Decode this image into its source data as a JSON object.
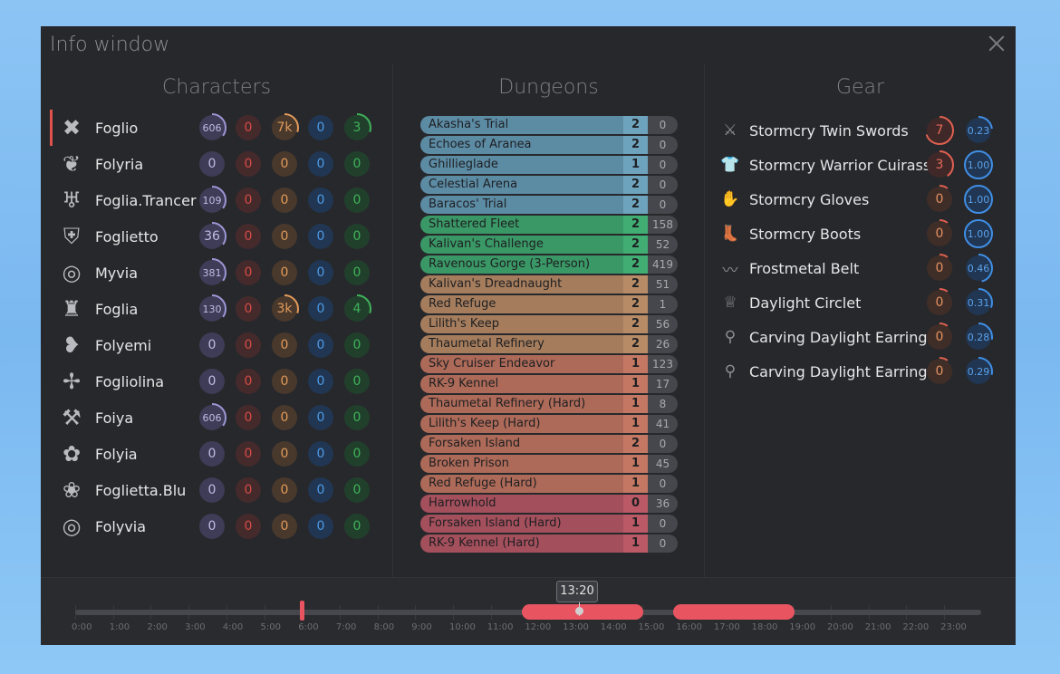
{
  "window": {
    "title": "Info window"
  },
  "characters": {
    "heading": "Characters",
    "rows": [
      {
        "name": "Foglio",
        "icon": "crossed-swords-class-icon",
        "active": true,
        "vals": [
          "606",
          "0",
          "7k",
          "0",
          "3"
        ]
      },
      {
        "name": "Folyria",
        "icon": "dragon-claw-class-icon",
        "vals": [
          "0",
          "0",
          "0",
          "0",
          "0"
        ]
      },
      {
        "name": "Foglia.Trancer",
        "icon": "flame-wings-class-icon",
        "vals": [
          "109",
          "0",
          "0",
          "0",
          "0"
        ]
      },
      {
        "name": "Foglietto",
        "icon": "shield-crest-class-icon",
        "vals": [
          "36",
          "0",
          "0",
          "0",
          "0"
        ]
      },
      {
        "name": "Myvia",
        "icon": "swirl-ring-class-icon",
        "vals": [
          "381",
          "0",
          "0",
          "0",
          "0"
        ]
      },
      {
        "name": "Foglia",
        "icon": "helmet-class-icon",
        "vals": [
          "130",
          "0",
          "3k",
          "0",
          "4"
        ]
      },
      {
        "name": "Folyemi",
        "icon": "winged-heart-class-icon",
        "vals": [
          "0",
          "0",
          "0",
          "0",
          "0"
        ]
      },
      {
        "name": "Fogliolina",
        "icon": "shuriken-class-icon",
        "vals": [
          "0",
          "0",
          "0",
          "0",
          "0"
        ]
      },
      {
        "name": "Foiya",
        "icon": "hammer-cross-class-icon",
        "vals": [
          "606",
          "0",
          "0",
          "0",
          "0"
        ]
      },
      {
        "name": "Folyia",
        "icon": "gear-flower-class-icon",
        "vals": [
          "0",
          "0",
          "0",
          "0",
          "0"
        ]
      },
      {
        "name": "Foglietta.Blu",
        "icon": "lotus-class-icon",
        "vals": [
          "0",
          "0",
          "0",
          "0",
          "0"
        ]
      },
      {
        "name": "Folyvia",
        "icon": "swirl-ring-class-icon",
        "vals": [
          "0",
          "0",
          "0",
          "0",
          "0"
        ]
      }
    ]
  },
  "dungeons": {
    "heading": "Dungeons",
    "rows": [
      {
        "name": "Akasha's Trial",
        "num": "2",
        "count": "0",
        "tier": "blue"
      },
      {
        "name": "Echoes of Aranea",
        "num": "2",
        "count": "0",
        "tier": "blue"
      },
      {
        "name": "Ghillieglade",
        "num": "1",
        "count": "0",
        "tier": "blue"
      },
      {
        "name": "Celestial Arena",
        "num": "2",
        "count": "0",
        "tier": "blue"
      },
      {
        "name": "Baracos' Trial",
        "num": "2",
        "count": "0",
        "tier": "blue"
      },
      {
        "name": "Shattered Fleet",
        "num": "2",
        "count": "158",
        "tier": "green"
      },
      {
        "name": "Kalivan's Challenge",
        "num": "2",
        "count": "52",
        "tier": "green"
      },
      {
        "name": "Ravenous Gorge (3-Person)",
        "num": "2",
        "count": "419",
        "tier": "green"
      },
      {
        "name": "Kalivan's Dreadnaught",
        "num": "2",
        "count": "51",
        "tier": "tan"
      },
      {
        "name": "Red Refuge",
        "num": "2",
        "count": "1",
        "tier": "tan"
      },
      {
        "name": "Lilith's Keep",
        "num": "2",
        "count": "56",
        "tier": "tan"
      },
      {
        "name": "Thaumetal Refinery",
        "num": "2",
        "count": "26",
        "tier": "tan"
      },
      {
        "name": "Sky Cruiser Endeavor",
        "num": "1",
        "count": "123",
        "tier": "brown"
      },
      {
        "name": "RK-9 Kennel",
        "num": "1",
        "count": "17",
        "tier": "brown"
      },
      {
        "name": "Thaumetal Refinery (Hard)",
        "num": "1",
        "count": "8",
        "tier": "brown"
      },
      {
        "name": "Lilith's Keep (Hard)",
        "num": "1",
        "count": "41",
        "tier": "brown"
      },
      {
        "name": "Forsaken Island",
        "num": "2",
        "count": "0",
        "tier": "brown"
      },
      {
        "name": "Broken Prison",
        "num": "1",
        "count": "45",
        "tier": "brown"
      },
      {
        "name": "Red Refuge (Hard)",
        "num": "1",
        "count": "0",
        "tier": "brown"
      },
      {
        "name": "Harrowhold",
        "num": "0",
        "count": "36",
        "tier": "red"
      },
      {
        "name": "Forsaken Island (Hard)",
        "num": "1",
        "count": "0",
        "tier": "red"
      },
      {
        "name": "RK-9 Kennel (Hard)",
        "num": "1",
        "count": "0",
        "tier": "red"
      }
    ],
    "tier_colors": {
      "blue": {
        "name": "#5c8ba4",
        "num": "#6ea3bd"
      },
      "green": {
        "name": "#3a9866",
        "num": "#41ad72"
      },
      "tan": {
        "name": "#a57d5d",
        "num": "#b78b66"
      },
      "brown": {
        "name": "#ad6a58",
        "num": "#c47863"
      },
      "red": {
        "name": "#a44f5c",
        "num": "#bb5966"
      }
    }
  },
  "gear": {
    "heading": "Gear",
    "rows": [
      {
        "name": "Stormcry Twin Swords",
        "icon": "twin-swords-icon",
        "red": "7",
        "blue": "0.23",
        "red_fill": 0.7,
        "blue_fill": 0.23
      },
      {
        "name": "Stormcry Warrior Cuirass",
        "icon": "cuirass-icon",
        "red": "3",
        "blue": "1.00",
        "red_fill": 0.4,
        "blue_fill": 1.0
      },
      {
        "name": "Stormcry Gloves",
        "icon": "gloves-icon",
        "red": "0",
        "blue": "1.00",
        "red_fill": 0.1,
        "blue_fill": 1.0
      },
      {
        "name": "Stormcry Boots",
        "icon": "boots-icon",
        "red": "0",
        "blue": "1.00",
        "red_fill": 0.1,
        "blue_fill": 1.0
      },
      {
        "name": "Frostmetal Belt",
        "icon": "belt-icon",
        "red": "0",
        "blue": "0.46",
        "red_fill": 0.1,
        "blue_fill": 0.46
      },
      {
        "name": "Daylight Circlet",
        "icon": "circlet-icon",
        "red": "0",
        "blue": "0.31",
        "red_fill": 0.1,
        "blue_fill": 0.31
      },
      {
        "name": "Carving Daylight Earring",
        "icon": "earring-icon",
        "red": "0",
        "blue": "0.28",
        "red_fill": 0.1,
        "blue_fill": 0.28
      },
      {
        "name": "Carving Daylight Earring",
        "icon": "earring-icon",
        "red": "0",
        "blue": "0.29",
        "red_fill": 0.1,
        "blue_fill": 0.29
      }
    ]
  },
  "timeline": {
    "now_label": "13:20",
    "hours": [
      "0:00",
      "1:00",
      "2:00",
      "3:00",
      "4:00",
      "5:00",
      "6:00",
      "7:00",
      "8:00",
      "9:00",
      "10:00",
      "11:00",
      "12:00",
      "13:00",
      "14:00",
      "15:00",
      "16:00",
      "17:00",
      "18:00",
      "19:00",
      "20:00",
      "21:00",
      "22:00",
      "23:00"
    ]
  }
}
